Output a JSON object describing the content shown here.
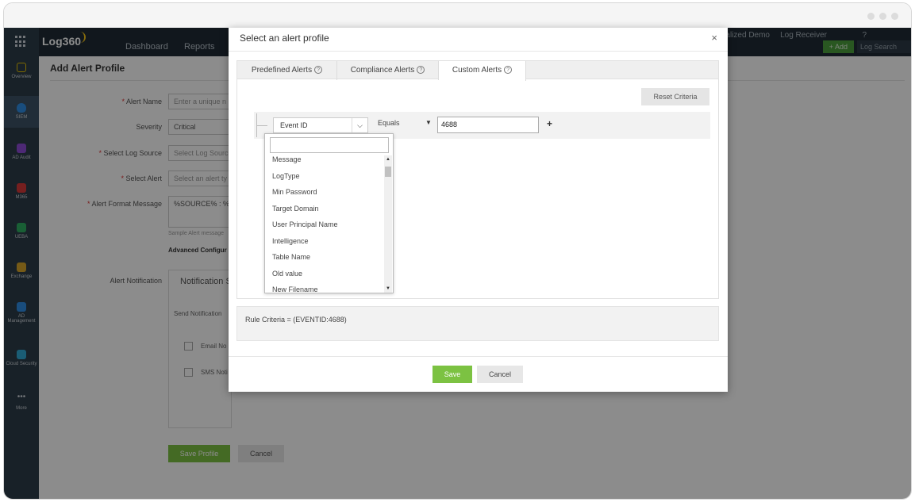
{
  "app": {
    "logo": "Log360"
  },
  "topnav": {
    "dashboard": "Dashboard",
    "reports": "Reports"
  },
  "topright": {
    "demo": "alized Demo",
    "log_receiver": "Log Receiver",
    "help": "?",
    "add": "+ Add",
    "log_search": "Log Search"
  },
  "sidebar": {
    "items": [
      {
        "label": "Overview",
        "icon": "overview-icon",
        "color": "#e6c200"
      },
      {
        "label": "SIEM",
        "icon": "shield-icon",
        "color": "#2f8de4"
      },
      {
        "label": "AD Audit",
        "icon": "search-icon",
        "color": "#8c4bd6"
      },
      {
        "label": "M365",
        "icon": "office-icon",
        "color": "#d63a3a"
      },
      {
        "label": "UEBA",
        "icon": "eye-icon",
        "color": "#2fae62"
      },
      {
        "label": "Exchange",
        "icon": "mail-icon",
        "color": "#d6a42b"
      },
      {
        "label": "AD Management",
        "icon": "ad-icon",
        "color": "#2f8de4"
      },
      {
        "label": "Cloud Security",
        "icon": "cloud-icon",
        "color": "#31a9d6"
      },
      {
        "label": "More",
        "icon": "more-icon",
        "color": "#cfd6dc"
      }
    ]
  },
  "form": {
    "title": "Add Alert Profile",
    "alert_name_label": "Alert Name",
    "alert_name_placeholder": "Enter a unique n",
    "severity_label": "Severity",
    "severity_value": "Critical",
    "log_source_label": "Select Log Source",
    "log_source_placeholder": "Select Log Sourc",
    "select_alert_label": "Select Alert",
    "select_alert_placeholder": "Select an alert ty",
    "format_label": "Alert Format Message",
    "format_value": "%SOURCE% : %M",
    "sample_text": "Sample Alert message",
    "advanced": "Advanced Configur",
    "notification_label": "Alert Notification",
    "notification_settings": "Notification S",
    "send_notification": "Send Notification",
    "email": "Email No",
    "sms": "SMS Noti",
    "save_profile": "Save Profile",
    "cancel": "Cancel"
  },
  "modal": {
    "title": "Select an alert profile",
    "close": "×",
    "tabs": [
      {
        "label": "Predefined Alerts",
        "help": "?"
      },
      {
        "label": "Compliance Alerts",
        "help": "?"
      },
      {
        "label": "Custom Alerts",
        "help": "?"
      }
    ],
    "reset": "Reset Criteria",
    "field_value": "Event ID",
    "operator": "Equals",
    "value": "4688",
    "plus": "+",
    "criteria": "Rule Criteria = (EVENTID:4688)",
    "save": "Save",
    "cancel": "Cancel",
    "dropdown_items": [
      "Message",
      "LogType",
      "Min Password",
      "Target Domain",
      "User Principal Name",
      "Intelligence",
      "Table Name",
      "Old value",
      "New Filename"
    ]
  }
}
